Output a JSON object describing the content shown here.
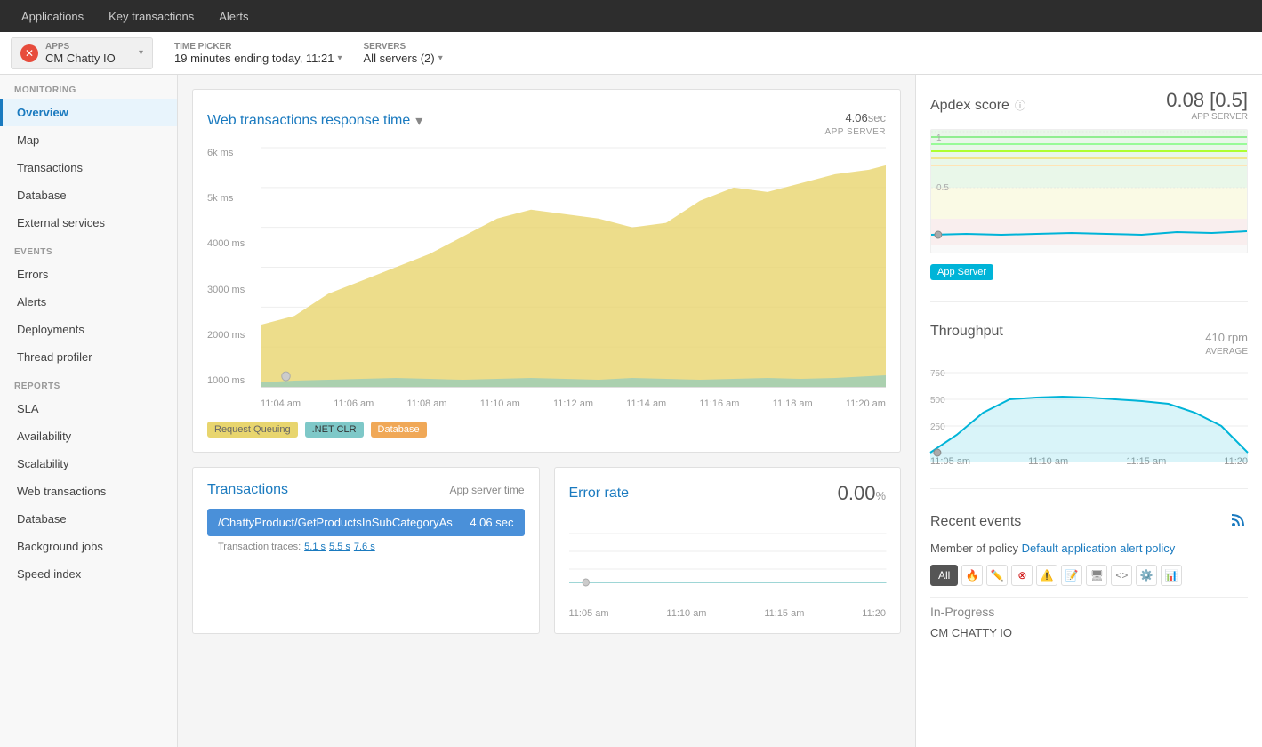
{
  "topNav": {
    "items": [
      "Applications",
      "Key transactions",
      "Alerts"
    ]
  },
  "appBar": {
    "appsLabel": "APPS",
    "appName": "CM Chatty IO",
    "timePicker": {
      "label": "TIME PICKER",
      "value": "19 minutes ending today, 11:21"
    },
    "servers": {
      "label": "SERVERS",
      "value": "All servers (2)"
    }
  },
  "sidebar": {
    "monitoring": {
      "label": "MONITORING",
      "items": [
        "Overview",
        "Map",
        "Transactions",
        "Database",
        "External services"
      ]
    },
    "events": {
      "label": "EVENTS",
      "items": [
        "Errors",
        "Alerts",
        "Deployments",
        "Thread profiler"
      ]
    },
    "reports": {
      "label": "REPORTS",
      "items": [
        "SLA",
        "Availability",
        "Scalability",
        "Web transactions",
        "Database",
        "Background jobs",
        "Speed index"
      ]
    }
  },
  "mainChart": {
    "title": "Web transactions response time",
    "value": "4.06",
    "valueUnit": "sec",
    "serverLabel": "APP SERVER",
    "yLabels": [
      "6k ms",
      "5k ms",
      "4000 ms",
      "3000 ms",
      "2000 ms",
      "1000 ms"
    ],
    "xLabels": [
      "11:04 am",
      "11:06 am",
      "11:08 am",
      "11:10 am",
      "11:12 am",
      "11:14 am",
      "11:16 am",
      "11:18 am",
      "11:20 am"
    ],
    "legend": [
      {
        "label": "Request Queuing",
        "color": "#e8d56e",
        "bg": "#e8d56e"
      },
      {
        "label": ".NET CLR",
        "color": "#7ec8c8",
        "bg": "#7ec8c8"
      },
      {
        "label": "Database",
        "color": "#f0a857",
        "bg": "#f0a857"
      }
    ]
  },
  "apdex": {
    "title": "Apdex score",
    "value": "0.08 [0.5]",
    "serverLabel": "APP SERVER",
    "yLabels": [
      "1",
      "0.5"
    ],
    "badge": "App Server"
  },
  "throughput": {
    "title": "Throughput",
    "value": "410",
    "valueUnit": "rpm",
    "avgLabel": "AVERAGE",
    "yLabels": [
      "750",
      "500",
      "250"
    ],
    "xLabels": [
      "11:05 am",
      "11:10 am",
      "11:15 am",
      "11:20"
    ]
  },
  "transactions": {
    "title": "Transactions",
    "metaLabel": "App server time",
    "topRow": {
      "name": "/ChattyProduct/GetProductsInSubCategoryAs",
      "value": "4.06 sec"
    },
    "traces": {
      "label": "Transaction traces:",
      "values": [
        "5.1 s",
        "5.5 s",
        "7.6 s"
      ]
    }
  },
  "errorRate": {
    "title": "Error rate",
    "value": "0.00",
    "valueUnit": "%",
    "xLabels": [
      "11:05 am",
      "11:10 am",
      "11:15 am",
      "11:20"
    ]
  },
  "recentEvents": {
    "title": "Recent events",
    "policyText": "Member of policy ",
    "policyLink": "Default application alert policy",
    "filters": [
      "All",
      "🔥",
      "✏️",
      "⊗",
      "⚠️",
      "✏️",
      "□",
      "<>",
      "⚙️",
      "📊"
    ],
    "inProgress": "In-Progress",
    "eventItem": "CM CHATTY IO"
  }
}
